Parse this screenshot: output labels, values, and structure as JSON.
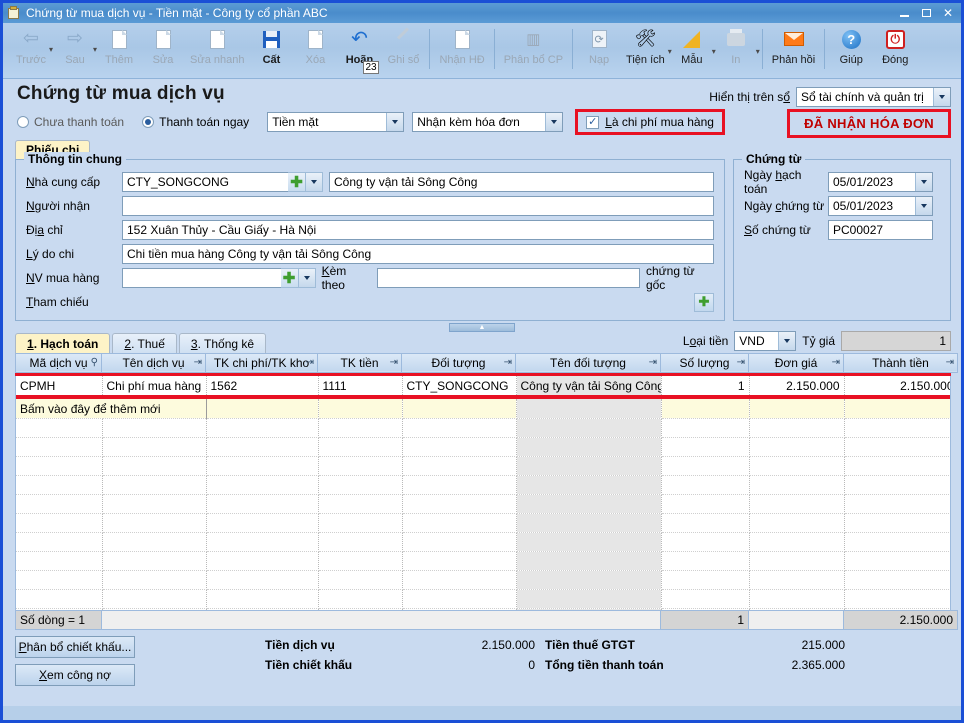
{
  "window": {
    "title": "Chứng từ mua dịch vụ - Tiền mặt - Công ty cổ phần ABC",
    "minimize": "–",
    "maximize": "□",
    "close": "✕"
  },
  "toolbar": {
    "items": [
      {
        "label": "Trước",
        "icon": "back-arrow-icon",
        "enabled": false,
        "caret": true
      },
      {
        "label": "Sau",
        "icon": "forward-arrow-icon",
        "enabled": false,
        "caret": true
      },
      {
        "label": "Thêm",
        "icon": "add-document-icon",
        "enabled": false,
        "caret": false
      },
      {
        "label": "Sửa",
        "icon": "edit-document-icon",
        "enabled": false,
        "caret": false
      },
      {
        "label": "Sửa nhanh",
        "icon": "quick-edit-icon",
        "enabled": false,
        "caret": false
      },
      {
        "label": "Cất",
        "icon": "save-icon",
        "enabled": true,
        "caret": false
      },
      {
        "label": "Xóa",
        "icon": "delete-document-icon",
        "enabled": false,
        "caret": false
      },
      {
        "label": "Hoãn",
        "icon": "undo-icon",
        "enabled": true,
        "caret": false,
        "badge": "23"
      },
      {
        "label": "Ghi sổ",
        "icon": "pencil-icon",
        "enabled": false,
        "caret": false
      },
      {
        "label": "Nhận HĐ",
        "icon": "receive-invoice-icon",
        "enabled": false,
        "caret": false
      },
      {
        "label": "Phân bổ CP",
        "icon": "allocate-cost-icon",
        "enabled": false,
        "caret": false
      },
      {
        "label": "Nạp",
        "icon": "reload-icon",
        "enabled": false,
        "caret": false
      },
      {
        "label": "Tiện ích",
        "icon": "tools-icon",
        "enabled": true,
        "caret": true
      },
      {
        "label": "Mẫu",
        "icon": "ruler-template-icon",
        "enabled": true,
        "caret": true
      },
      {
        "label": "In",
        "icon": "printer-icon",
        "enabled": false,
        "caret": true
      },
      {
        "label": "Phản hồi",
        "icon": "envelope-icon",
        "enabled": true,
        "caret": false
      },
      {
        "label": "Giúp",
        "icon": "help-circle-icon",
        "enabled": true,
        "caret": false
      },
      {
        "label": "Đóng",
        "icon": "power-close-icon",
        "enabled": true,
        "caret": false
      }
    ]
  },
  "page": {
    "title": "Chứng từ mua dịch vụ",
    "display_on_book_label": "Hiển thị trên sổ",
    "display_on_book_value": "Sổ tài chính và quản trị"
  },
  "options": {
    "unpaid_label": "Chưa thanh toán",
    "paid_now_label": "Thanh toán ngay",
    "paid_now_selected": true,
    "payment_method": "Tiền mặt",
    "invoice_attach": "Nhận kèm hóa đơn",
    "is_purchase_cost_label": "Là chi phí mua hàng",
    "is_purchase_cost_checked": true,
    "invoice_received_badge": "ĐÃ NHẬN HÓA ĐƠN"
  },
  "voucher_tab": {
    "label": "Phiếu chi"
  },
  "general_info": {
    "legend": "Thông tin chung",
    "supplier_label": "Nhà cung cấp",
    "supplier_code": "CTY_SONGCONG",
    "supplier_name": "Công ty vận tải Sông Công",
    "receiver_label": "Người nhận",
    "receiver_value": "",
    "address_label": "Địa chỉ",
    "address_value": "152 Xuân Thủy - Cầu Giấy - Hà Nội",
    "reason_label": "Lý do chi",
    "reason_value": "Chi tiền mua hàng Công ty vận tải Sông Công",
    "buyer_label": "NV mua hàng",
    "buyer_value": "",
    "attach_label": "Kèm theo",
    "attach_value": "",
    "attach_suffix": "chứng từ gốc",
    "reference_label": "Tham chiếu",
    "reference_value": ""
  },
  "voucher_info": {
    "legend": "Chứng từ",
    "posting_date_label": "Ngày hạch toán",
    "posting_date": "05/01/2023",
    "voucher_date_label": "Ngày chứng từ",
    "voucher_date": "05/01/2023",
    "voucher_no_label": "Số chứng từ",
    "voucher_no": "PC00027"
  },
  "grid_tabs": [
    {
      "label": "1. Hạch toán",
      "active": true
    },
    {
      "label": "2. Thuế",
      "active": false
    },
    {
      "label": "3. Thống kê",
      "active": false
    }
  ],
  "currency": {
    "label": "Loại tiền",
    "value": "VND",
    "rate_label": "Tỷ giá",
    "rate_value": "1"
  },
  "table": {
    "columns": [
      "Mã dịch vụ",
      "Tên dịch vụ",
      "TK chi phí/TK kho",
      "TK tiền",
      "Đối tượng",
      "Tên đối tượng",
      "Số lượng",
      "Đơn giá",
      "Thành tiền"
    ],
    "rows": [
      {
        "ma_dich_vu": "CPMH",
        "ten_dich_vu": "Chi phí mua hàng",
        "tk_chi_phi": "1562",
        "tk_tien": "1111",
        "doi_tuong": "CTY_SONGCONG",
        "ten_doi_tuong": "Công ty vận tải Sông Công",
        "so_luong": "1",
        "don_gia": "2.150.000",
        "thanh_tien": "2.150.000"
      }
    ],
    "new_row_hint": "Bấm vào đây để thêm mới",
    "row_count_label": "Số dòng = 1",
    "total_quantity": "1",
    "total_amount": "2.150.000"
  },
  "footer": {
    "allocate_discount_button": "Phân bổ chiết khấu...",
    "view_debt_button": "Xem công nợ",
    "service_amount_label": "Tiền dịch vụ",
    "service_amount_value": "2.150.000",
    "discount_label": "Tiền chiết khấu",
    "discount_value": "0",
    "vat_label": "Tiền thuế GTGT",
    "vat_value": "215.000",
    "total_label": "Tổng tiền thanh toán",
    "total_value": "2.365.000"
  },
  "colors": {
    "accent_blue": "#1a4fd6",
    "highlight_red": "#e81123",
    "badge_red": "#c00000",
    "panel_bg": "#c9daf0",
    "tab_yellow": "#fdf3c7"
  }
}
